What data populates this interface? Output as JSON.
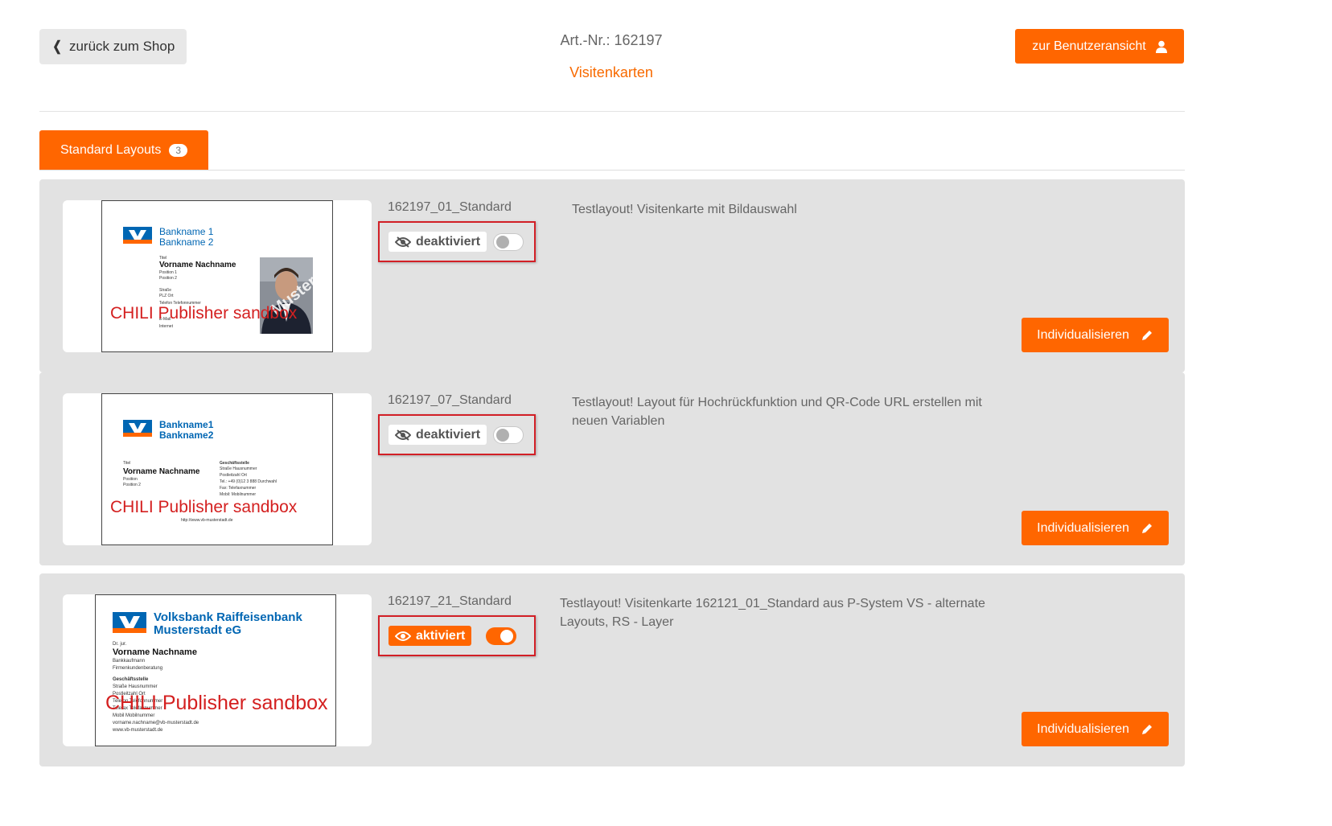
{
  "header": {
    "back_label": "zurück zum Shop",
    "article_number": "Art.-Nr.: 162197",
    "product_title": "Visitenkarten",
    "user_view_label": "zur Benutzeransicht"
  },
  "tab": {
    "label": "Standard Layouts",
    "count": "3"
  },
  "colors": {
    "accent": "#ff6600",
    "highlight_frame": "#d21f26",
    "card_bg": "#e2e2e2"
  },
  "watermark": "CHILI Publisher sandbox",
  "layouts": [
    {
      "code": "162197_01_Standard",
      "state_label": "deaktiviert",
      "active": false,
      "description": "Testlayout! Visitenkarte mit Bildauswahl",
      "button_label": "Individualisieren",
      "preview": {
        "bank_line1": "Bankname 1",
        "bank_line2": "Bankname 2",
        "title": "Titel",
        "name": "Vorname Nachname",
        "position1": "Position 1",
        "position2": "Position 2",
        "street": "Straße",
        "city": "PLZ Ort",
        "phone": "Telefon Telefonnummer",
        "email": "E-Mail",
        "web": "Internet",
        "photo_stamp": "Muster"
      }
    },
    {
      "code": "162197_07_Standard",
      "state_label": "deaktiviert",
      "active": false,
      "description": "Testlayout! Layout für Hochrückfunktion und QR-Code URL erstellen mit neuen Variablen",
      "button_label": "Individualisieren",
      "preview": {
        "bank_line1": "Bankname1",
        "bank_line2": "Bankname2",
        "title": "Titel",
        "name": "Vorname Nachname",
        "position1": "Position",
        "position2": "Position 2",
        "office": "Geschäftsstelle",
        "street": "Straße Hausnummer",
        "city": "Postleitzahl Ort",
        "phone": "Tel.: +49 (0)12 3 888 Durchwahl",
        "fax": "Fax: Telefaxnummer",
        "mobile": "Mobil: Mobilnummer",
        "web": "http://www.vb-musterstadt.de"
      }
    },
    {
      "code": "162197_21_Standard",
      "state_label": "aktiviert",
      "active": true,
      "description": "Testlayout! Visitenkarte 162121_01_Standard aus P-System VS - alternate Layouts, RS - Layer",
      "button_label": "Individualisieren",
      "preview": {
        "bank_line1": "Volksbank Raiffeisenbank",
        "bank_line2": "Musterstadt eG",
        "title": "Dr. jur.",
        "name": "Vorname Nachname",
        "position1": "Bankkaufmann",
        "position2": "Firmenkundenberatung",
        "office": "Geschäftsstelle",
        "street": "Straße Hausnummer",
        "city": "Postleitzahl Ort",
        "phone": "Telefon Telefonnummer",
        "fax": "Telefax Telefaxnummer",
        "mobile": "Mobil Mobilnummer",
        "email": "vorname.nachname@vb-musterstadt.de",
        "web": "www.vb-musterstadt.de"
      }
    }
  ]
}
